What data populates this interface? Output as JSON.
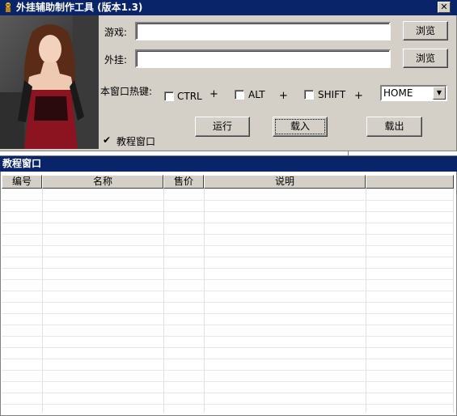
{
  "window": {
    "title": "外挂辅助制作工具 (版本1.3)",
    "close_glyph": "✕"
  },
  "form": {
    "game_label": "游戏:",
    "game_value": "",
    "plugin_label": "外挂:",
    "plugin_value": "",
    "browse_label": "浏览",
    "hotkey_label": "本窗口热键:",
    "ctrl_label": "CTRL",
    "alt_label": "ALT",
    "shift_label": "SHIFT",
    "plus": "+",
    "key_selected": "HOME",
    "run_label": "运行",
    "load_label": "载入",
    "unload_label": "载出",
    "tutorial_checkbox_label": "教程窗口",
    "tutorial_checked": true
  },
  "tutorial_window": {
    "title": "教程窗口",
    "columns": [
      "编号",
      "名称",
      "售价",
      "说明",
      ""
    ]
  },
  "icons": {
    "app": "warning-figure-icon",
    "close": "close-icon",
    "dropdown": "dropdown-arrow-icon",
    "check": "checkmark-icon"
  },
  "colors": {
    "titlebar": "#0a246a",
    "face": "#d4d0c8",
    "photo_dress": "#8c1420"
  }
}
